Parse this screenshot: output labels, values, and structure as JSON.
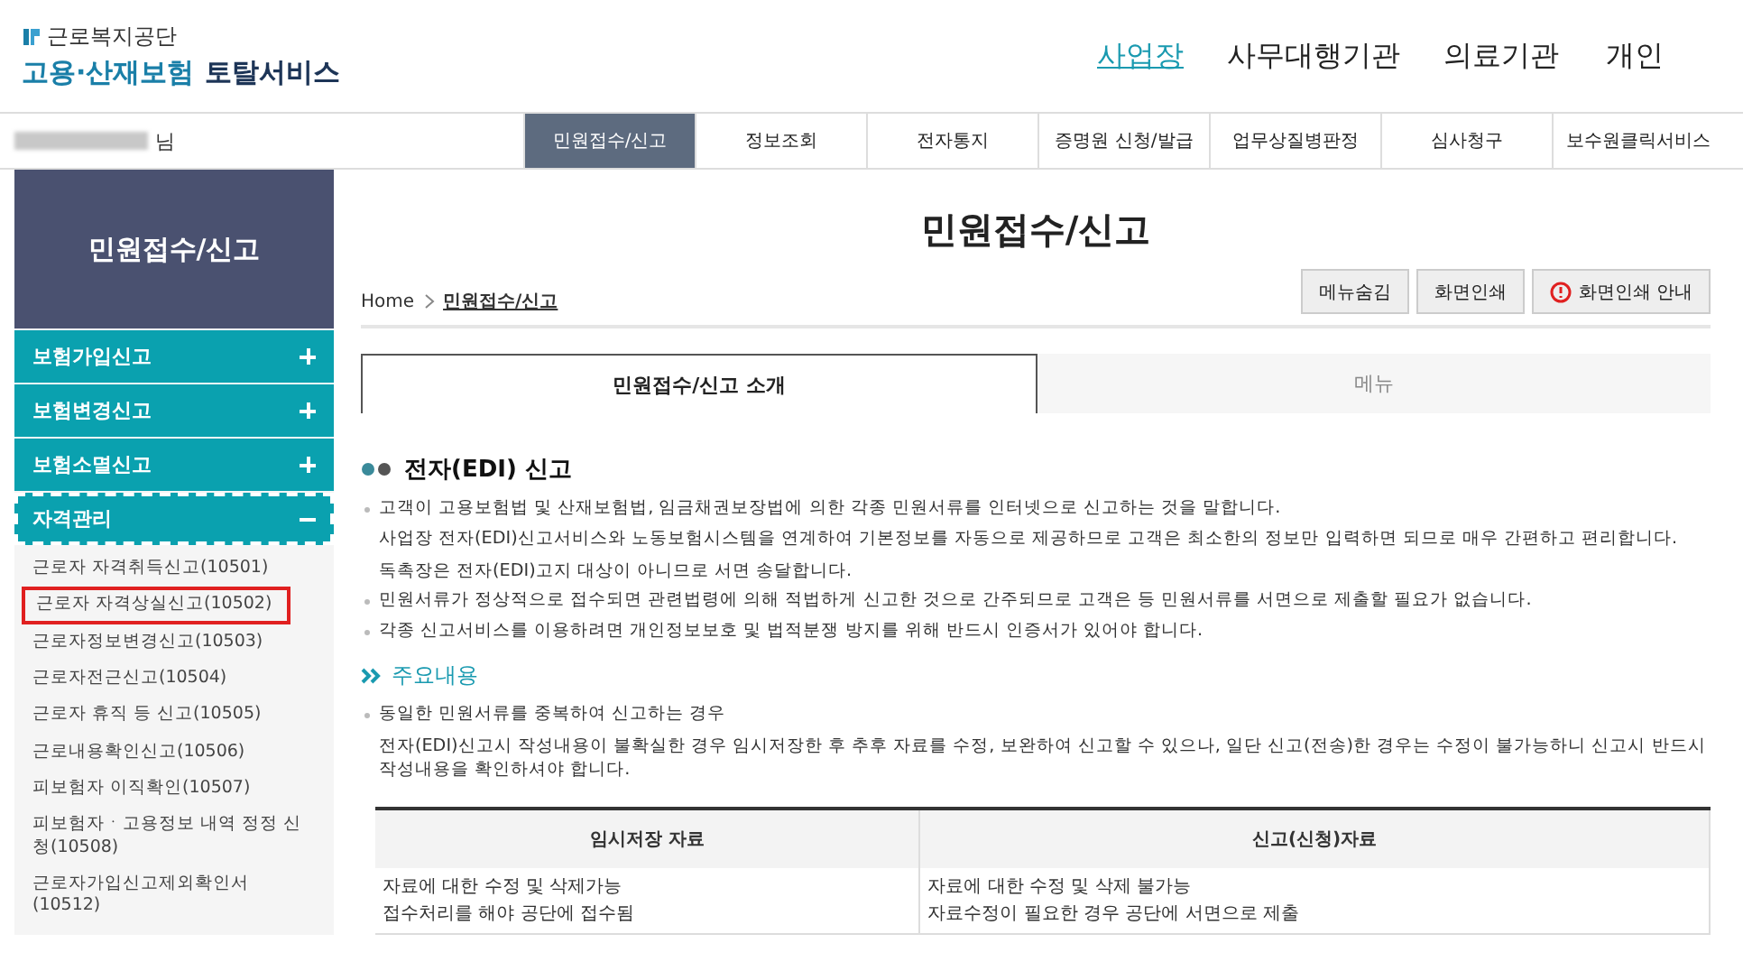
{
  "header": {
    "org": "근로복지공단",
    "service_main": "고용·산재보험",
    "service_sub": "토탈서비스",
    "user_types": [
      {
        "label": "사업장",
        "selected": true
      },
      {
        "label": "사무대행기관",
        "selected": false
      },
      {
        "label": "의료기관",
        "selected": false
      },
      {
        "label": "개인",
        "selected": false
      }
    ]
  },
  "user": {
    "suffix": "님"
  },
  "nav": [
    {
      "label": "민원접수/신고",
      "selected": true
    },
    {
      "label": "정보조회",
      "selected": false
    },
    {
      "label": "전자통지",
      "selected": false
    },
    {
      "label": "증명원 신청/발급",
      "selected": false
    },
    {
      "label": "업무상질병판정",
      "selected": false
    },
    {
      "label": "심사청구",
      "selected": false
    },
    {
      "label": "보수원클릭서비스",
      "selected": false
    }
  ],
  "sidebar": {
    "title": "민원접수/신고",
    "sections": [
      {
        "label": "보험가입신고",
        "expanded": false,
        "focused": false
      },
      {
        "label": "보험변경신고",
        "expanded": false,
        "focused": false
      },
      {
        "label": "보험소멸신고",
        "expanded": false,
        "focused": false
      },
      {
        "label": "자격관리",
        "expanded": true,
        "focused": true,
        "children": [
          {
            "label": "근로자 자격취득신고(10501)",
            "highlighted": false
          },
          {
            "label": "근로자 자격상실신고(10502)",
            "highlighted": true
          },
          {
            "label": "근로자정보변경신고(10503)",
            "highlighted": false
          },
          {
            "label": "근로자전근신고(10504)",
            "highlighted": false
          },
          {
            "label": "근로자 휴직 등 신고(10505)",
            "highlighted": false
          },
          {
            "label": "근로내용확인신고(10506)",
            "highlighted": false
          },
          {
            "label": "피보험자 이직확인(10507)",
            "highlighted": false
          },
          {
            "label": "피보험자ㆍ고용정보 내역 정정 신청(10508)",
            "highlighted": false
          },
          {
            "label": "근로자가입신고제외확인서(10512)",
            "highlighted": false
          }
        ]
      }
    ]
  },
  "page": {
    "title": "민원접수/신고",
    "breadcrumb": [
      "Home",
      "민원접수/신고"
    ],
    "buttons": [
      {
        "label": "메뉴숨김",
        "kind": "plain"
      },
      {
        "label": "화면인쇄",
        "kind": "plain"
      },
      {
        "label": "화면인쇄 안내",
        "kind": "info"
      }
    ],
    "tabs": [
      {
        "label": "민원접수/신고 소개",
        "selected": true
      },
      {
        "label": "메뉴",
        "selected": false
      }
    ]
  },
  "section1": {
    "heading": "전자(EDI) 신고",
    "items": [
      {
        "lines": [
          "고객이 고용보험법 및 산재보험법, 임금채권보장법에 의한 각종 민원서류를 인터넷으로 신고하는 것을 말합니다.",
          "사업장 전자(EDI)신고서비스와 노동보험시스템을 연계하여 기본정보를 자동으로 제공하므로 고객은 최소한의 정보만 입력하면 되므로 매우 간편하고 편리합니다.",
          "독촉장은 전자(EDI)고지 대상이 아니므로 서면 송달합니다."
        ]
      },
      {
        "lines": [
          "민원서류가 정상적으로 접수되면 관련법령에 의해 적법하게 신고한 것으로 간주되므로 고객은 등 민원서류를 서면으로 제출할 필요가 없습니다."
        ]
      },
      {
        "lines": [
          "각종 신고서비스를 이용하려면 개인정보보호 및 법적분쟁 방지를 위해 반드시 인증서가 있어야 합니다."
        ]
      }
    ]
  },
  "section2": {
    "heading": "주요내용",
    "items": [
      {
        "lines": [
          "동일한 민원서류를 중복하여 신고하는 경우",
          "전자(EDI)신고시 작성내용이 불확실한 경우 임시저장한 후 추후 자료를 수정, 보완하여 신고할 수 있으나, 일단 신고(전송)한 경우는 수정이 불가능하니 신고시 반드시 작성내용을 확인하셔야 합니다."
        ]
      }
    ]
  },
  "table": {
    "columns": [
      "임시저장 자료",
      "신고(신청)자료"
    ],
    "rows": [
      [
        [
          "자료에 대한 수정 및 삭제가능",
          "접수처리를 해야 공단에 접수됨"
        ],
        [
          "자료에 대한 수정 및 삭제 불가능",
          "자료수정이 필요한 경우 공단에 서면으로 제출"
        ]
      ]
    ]
  }
}
